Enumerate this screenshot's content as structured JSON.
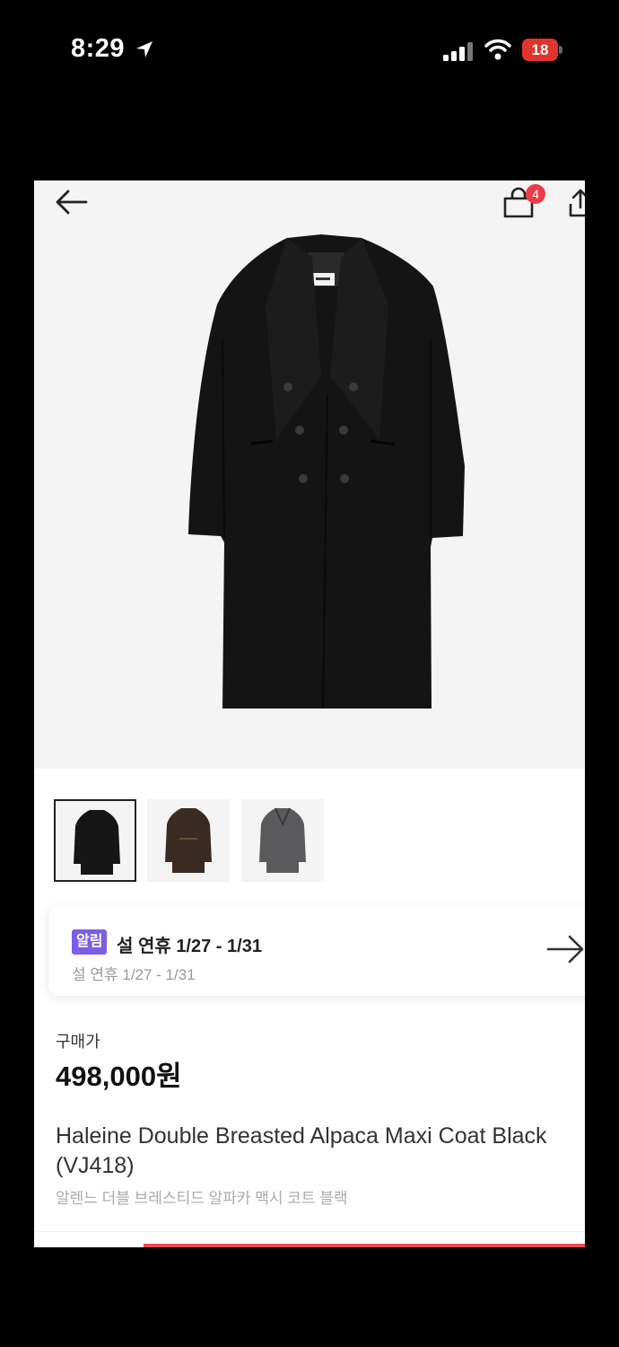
{
  "status_bar": {
    "time": "8:29",
    "battery": "18"
  },
  "header": {
    "cart_count": "4"
  },
  "notice": {
    "badge": "알림",
    "title": "설 연휴 1/27 - 1/31",
    "subtitle": "설 연휴 1/27 - 1/31"
  },
  "product": {
    "price_label": "구매가",
    "price": "498,000원",
    "name_en": "Haleine Double Breasted Alpaca Maxi Coat Black (VJ418)",
    "name_ko": "알렌느 더블 브레스티드 알파카 맥시 코트 블랙"
  },
  "thumbnails": [
    {
      "color": "black",
      "hex": "#161616"
    },
    {
      "color": "brown",
      "hex": "#3a2a22"
    },
    {
      "color": "grey",
      "hex": "#5a5a5c"
    }
  ],
  "colors": {
    "accent_badge": "#7b5ee8",
    "cart_badge": "#ee3b48",
    "battery": "#e0342e"
  }
}
